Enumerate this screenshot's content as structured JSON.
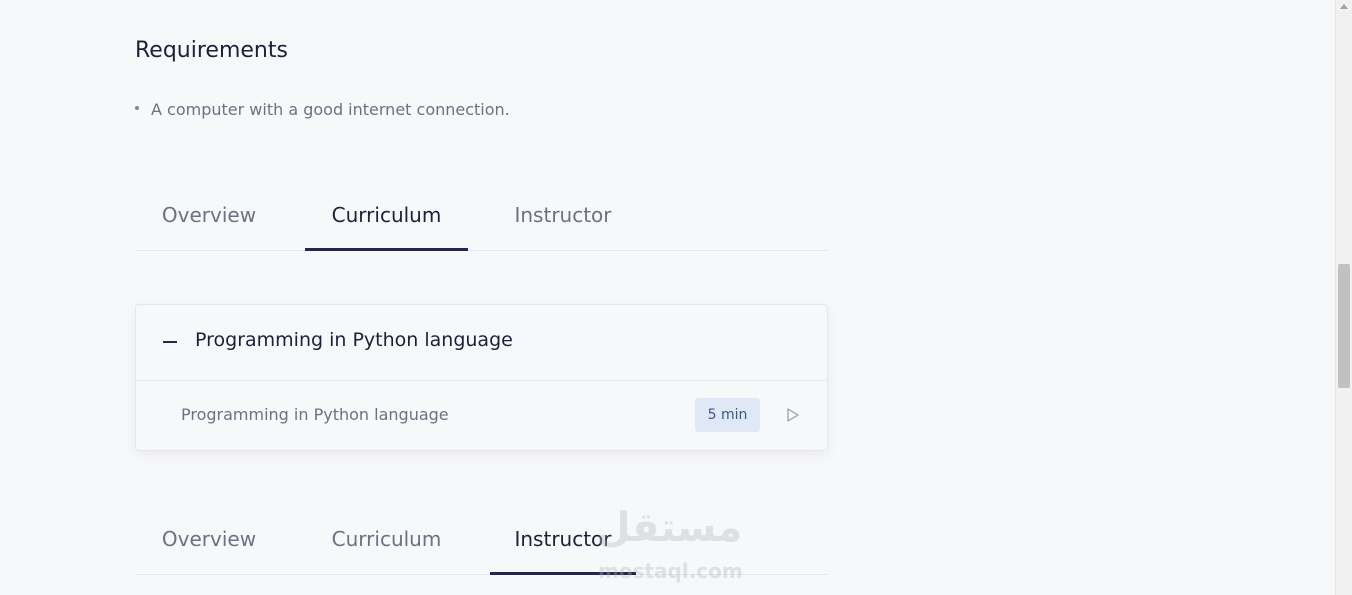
{
  "requirements": {
    "title": "Requirements",
    "items": [
      "A computer with a good internet connection."
    ]
  },
  "tabs_top": {
    "items": [
      "Overview",
      "Curriculum",
      "Instructor"
    ],
    "active": "Curriculum"
  },
  "curriculum": {
    "section_title": "Programming in Python language",
    "lessons": [
      {
        "title": "Programming in Python language",
        "duration": "5 min"
      }
    ]
  },
  "tabs_bottom": {
    "items": [
      "Overview",
      "Curriculum",
      "Instructor"
    ],
    "active": "Instructor"
  },
  "watermark": {
    "logo_text": "مستقل",
    "domain": "mostaql.com"
  },
  "colors": {
    "heading": "#1f1f3a",
    "muted_text": "#6b7280",
    "active_underline": "#26264a",
    "badge_bg": "#dfe8f4",
    "badge_text": "#3c5a86"
  }
}
